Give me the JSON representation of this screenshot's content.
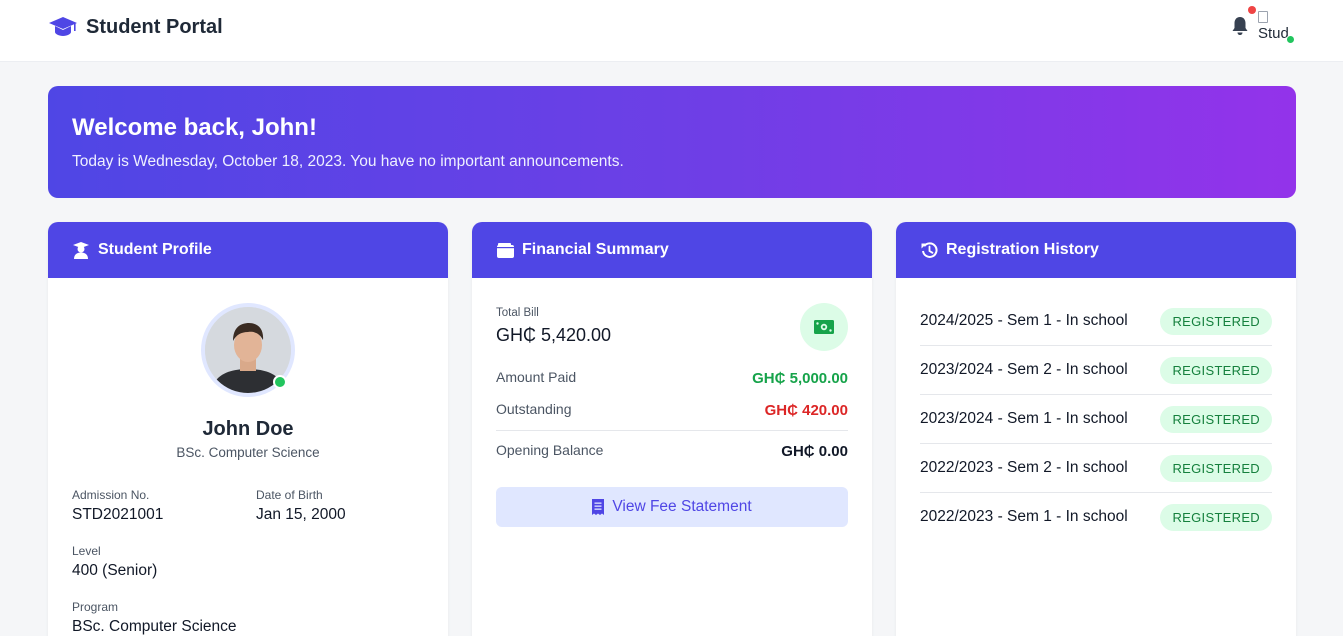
{
  "header": {
    "title": "Student Portal",
    "brand_icon": "graduation-cap-icon",
    "notification_icon": "bell-icon",
    "avatar_alt": "Stud"
  },
  "welcome": {
    "heading": "Welcome back, John!",
    "message": "Today is Wednesday, October 18, 2023. You have no important announcements."
  },
  "profile": {
    "title": "Student Profile",
    "icon": "user-graduate-icon",
    "name": "John Doe",
    "program_short": "BSc. Computer Science",
    "fields": {
      "admission_label": "Admission No.",
      "admission_value": "STD2021001",
      "dob_label": "Date of Birth",
      "dob_value": "Jan 15, 2000",
      "level_label": "Level",
      "level_value": "400 (Senior)",
      "program_label": "Program",
      "program_value": "BSc. Computer Science"
    }
  },
  "financial": {
    "title": "Financial Summary",
    "icon": "wallet-icon",
    "total_label": "Total Bill",
    "total_value": "GH₵ 5,420.00",
    "amount_paid_label": "Amount Paid",
    "amount_paid_value": "GH₵ 5,000.00",
    "outstanding_label": "Outstanding",
    "outstanding_value": "GH₵ 420.00",
    "opening_label": "Opening Balance",
    "opening_value": "GH₵ 0.00",
    "button_label": "View Fee Statement",
    "colors": {
      "paid": "#16a34a",
      "outstanding": "#dc2626"
    }
  },
  "registration": {
    "title": "Registration History",
    "icon": "history-icon",
    "items": [
      {
        "label": "2024/2025 - Sem 1 - In school",
        "status": "REGISTERED"
      },
      {
        "label": "2023/2024 - Sem 2 - In school",
        "status": "REGISTERED"
      },
      {
        "label": "2023/2024 - Sem 1 - In school",
        "status": "REGISTERED"
      },
      {
        "label": "2022/2023 - Sem 2 - In school",
        "status": "REGISTERED"
      },
      {
        "label": "2022/2023 - Sem 1 - In school",
        "status": "REGISTERED"
      }
    ]
  },
  "colors": {
    "primary": "#4f46e5",
    "gradient_end": "#9333ea",
    "success_bg": "#dcfce7",
    "success_text": "#15803d"
  }
}
